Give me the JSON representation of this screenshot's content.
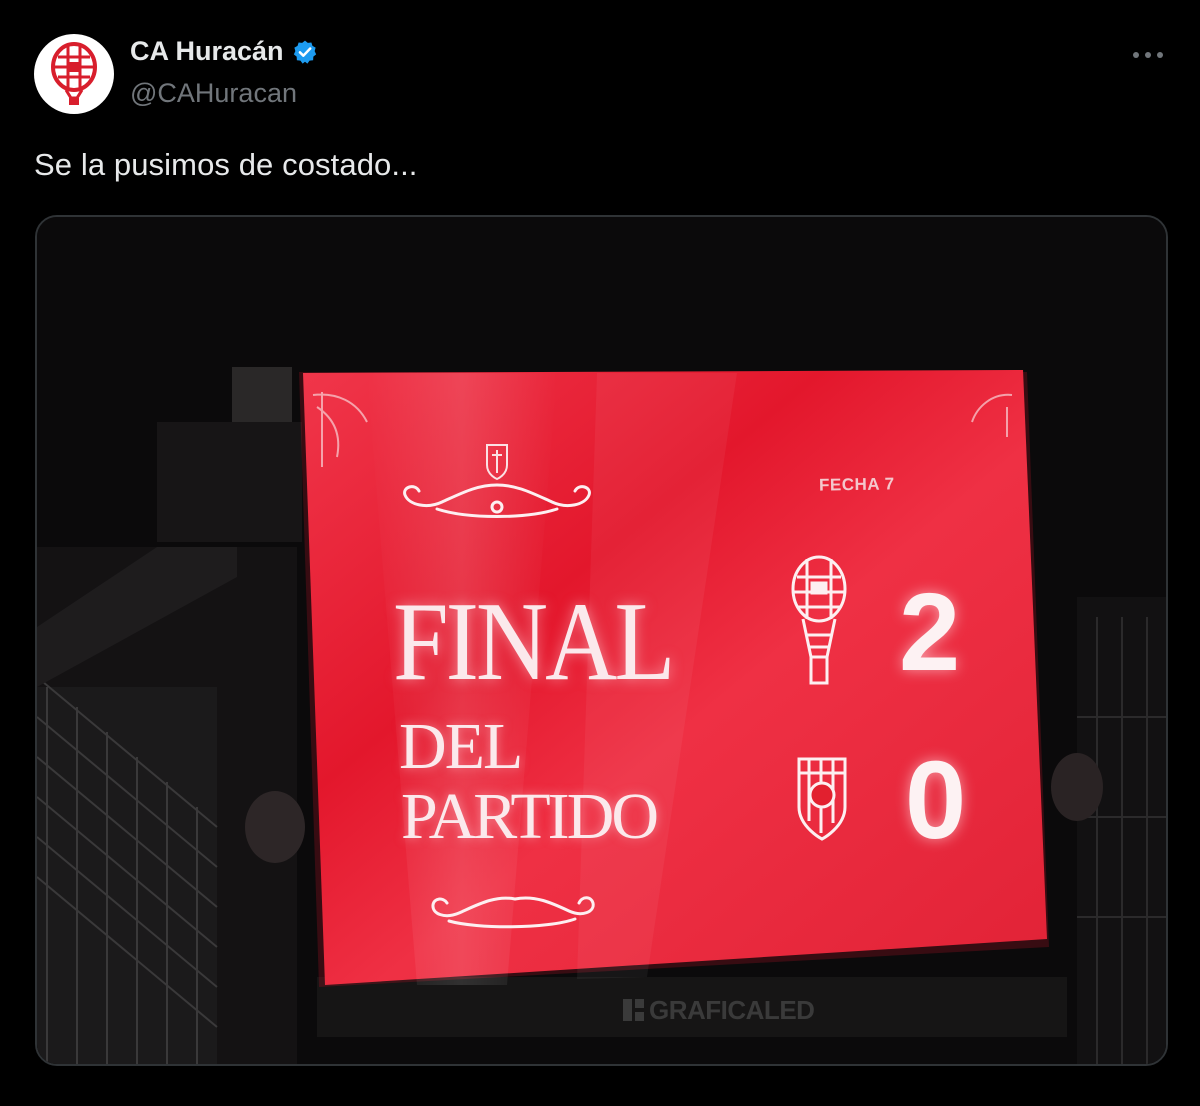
{
  "author": {
    "display_name": "CA Huracán",
    "handle": "@CAHuracan",
    "verified_color": "#1d9bf0"
  },
  "tweet": {
    "text": "Se la pusimos de costado..."
  },
  "icons": {
    "more": "more-options-icon",
    "verified": "verified-badge-icon",
    "avatar": "huracan-balloon-crest-icon"
  },
  "media": {
    "scoreboard": {
      "round": "FECHA 7",
      "title_line1": "FINAL",
      "title_line2": "DEL",
      "title_line3": "PARTIDO",
      "home_score": "2",
      "away_score": "0",
      "sponsor": "GRAFICALED"
    }
  },
  "colors": {
    "background": "#000000",
    "text_primary": "#e7e9ea",
    "text_secondary": "#71767b",
    "board_red": "#e8283a",
    "brand_red": "#d81e2c"
  }
}
